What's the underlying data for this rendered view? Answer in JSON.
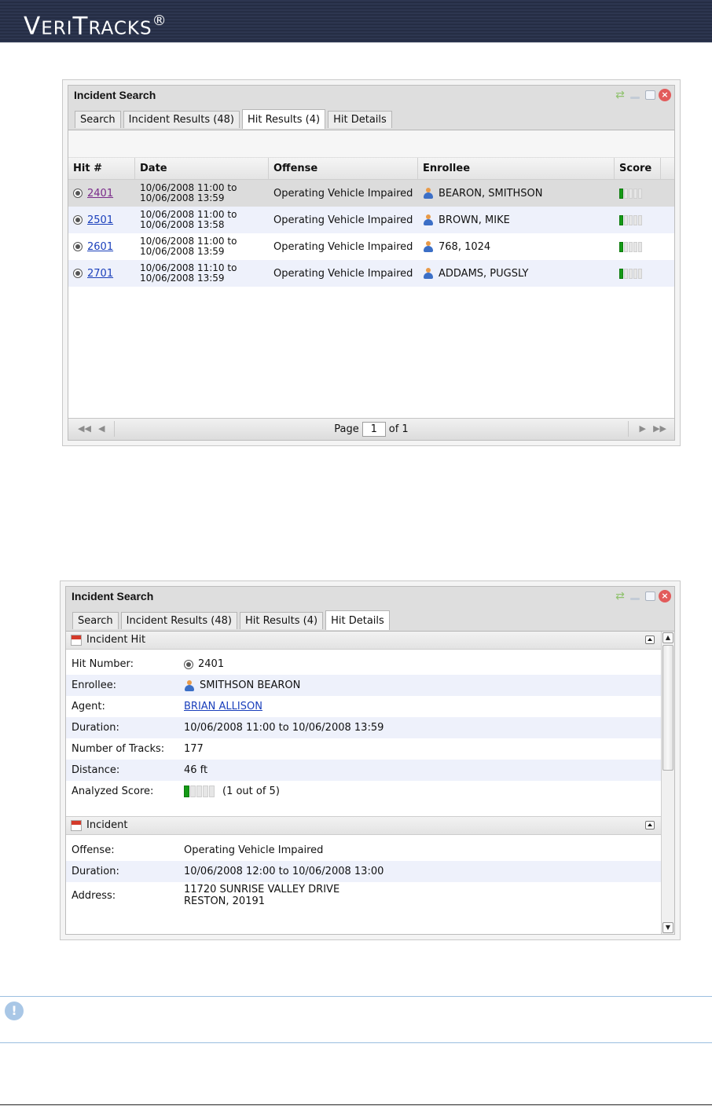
{
  "banner": {
    "brand_first": "V",
    "brand_rest1": "ERI",
    "brand_T": "T",
    "brand_rest2": "RACKS",
    "brand_reg": "®"
  },
  "window1": {
    "title": "Incident Search",
    "tabs": [
      "Search",
      "Incident Results (48)",
      "Hit Results (4)",
      "Hit Details"
    ],
    "active_tab": "Hit Results (4)",
    "columns": [
      "Hit #",
      "Date",
      "Offense",
      "Enrollee",
      "Score"
    ],
    "rows": [
      {
        "hit": "2401",
        "date1": "10/06/2008 11:00 to",
        "date2": "10/06/2008 13:59",
        "offense": "Operating Vehicle Impaired",
        "enrollee": "BEARON, SMITHSON",
        "score": 1
      },
      {
        "hit": "2501",
        "date1": "10/06/2008 11:00 to",
        "date2": "10/06/2008 13:58",
        "offense": "Operating Vehicle Impaired",
        "enrollee": "BROWN, MIKE",
        "score": 1
      },
      {
        "hit": "2601",
        "date1": "10/06/2008 11:00 to",
        "date2": "10/06/2008 13:59",
        "offense": "Operating Vehicle Impaired",
        "enrollee": "768, 1024",
        "score": 1
      },
      {
        "hit": "2701",
        "date1": "10/06/2008 11:10 to",
        "date2": "10/06/2008 13:59",
        "offense": "Operating Vehicle Impaired",
        "enrollee": "ADDAMS, PUGSLY",
        "score": 1
      }
    ],
    "pager": {
      "page_label": "Page",
      "page_value": "1",
      "of_label": "of 1"
    }
  },
  "window2": {
    "title": "Incident Search",
    "tabs": [
      "Search",
      "Incident Results (48)",
      "Hit Results (4)",
      "Hit Details"
    ],
    "active_tab": "Hit Details",
    "section1": {
      "title": "Incident Hit",
      "rows": [
        {
          "label": "Hit Number:",
          "value": "2401"
        },
        {
          "label": "Enrollee:",
          "value": "SMITHSON BEARON"
        },
        {
          "label": "Agent:",
          "value": "BRIAN ALLISON"
        },
        {
          "label": "Duration:",
          "value": "10/06/2008 11:00 to 10/06/2008 13:59"
        },
        {
          "label": "Number of Tracks:",
          "value": "177"
        },
        {
          "label": "Distance:",
          "value": "46 ft"
        },
        {
          "label": "Analyzed Score:",
          "value": "(1 out of 5)"
        }
      ],
      "score": 1
    },
    "section2": {
      "title": "Incident",
      "rows": [
        {
          "label": "Offense:",
          "value": "Operating Vehicle Impaired"
        },
        {
          "label": "Duration:",
          "value": "10/06/2008 12:00 to 10/06/2008 13:00"
        },
        {
          "label": "Address:",
          "value1": "11720 SUNRISE VALLEY DRIVE",
          "value2": "RESTON, 20191"
        }
      ]
    }
  },
  "colors": {
    "banner": "#2d3650",
    "score_on": "#159a16",
    "link": "#1a3fbb",
    "alt_row": "#eef1fb",
    "note_border": "#9bbfe0"
  }
}
